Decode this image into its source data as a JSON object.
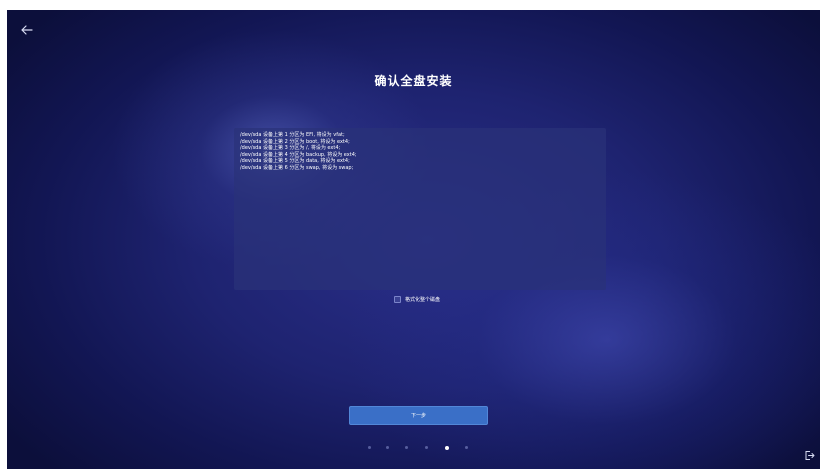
{
  "header": {
    "back_icon": "arrow-left-icon",
    "title": "确认全盘安装"
  },
  "partitions": [
    "/dev/sda 设备上第 1 分区为 EFI, 将设为 vfat;",
    "/dev/sda 设备上第 2 分区为 boot, 将设为 ext4;",
    "/dev/sda 设备上第 3 分区为 /, 将设为 ext4;",
    "/dev/sda 设备上第 4 分区为 backup, 将设为 ext4;",
    "/dev/sda 设备上第 5 分区为 data, 将设为 ext4;",
    "/dev/sda 设备上第 6 分区为 swap, 将设为 swap;"
  ],
  "format_option": {
    "label": "格式化整个磁盘",
    "checked": false
  },
  "next_button": {
    "label": "下一步",
    "color": "#3a6fc7"
  },
  "steps": {
    "total": 6,
    "current": 5
  },
  "footer": {
    "exit_icon": "exit-icon"
  }
}
